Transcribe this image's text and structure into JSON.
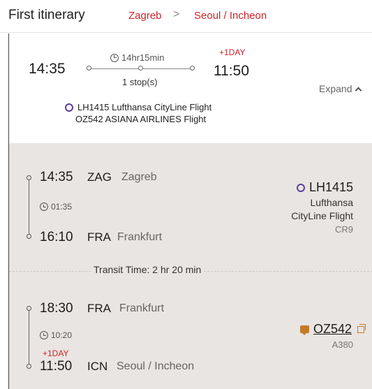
{
  "header": {
    "title": "First itinerary",
    "from": "Zagreb",
    "arrow": ">",
    "to": "Seoul / Incheon"
  },
  "summary": {
    "departure_time": "14:35",
    "arrival_time": "11:50",
    "plus_day": "+1DAY",
    "duration": "14hr15min",
    "stops": "1 stop(s)",
    "expand_label": "Expand",
    "flights": [
      {
        "label": "LH1415 Lufthansa CityLine Flight"
      },
      {
        "label": "OZ542 ASIANA AIRLINES Flight"
      }
    ]
  },
  "segments": [
    {
      "dep_time": "14:35",
      "dep_code": "ZAG",
      "dep_city": "Zagreb",
      "duration": "01:35",
      "arr_time": "16:10",
      "arr_code": "FRA",
      "arr_city": "Frankfurt",
      "flight_no": "LH1415",
      "operator_line1": "Lufthansa",
      "operator_line2": "CityLine Flight",
      "aircraft": "CR9"
    },
    {
      "dep_time": "18:30",
      "dep_code": "FRA",
      "dep_city": "Frankfurt",
      "duration": "10:20",
      "plus_day": "+1DAY",
      "arr_time": "11:50",
      "arr_code": "ICN",
      "arr_city": "Seoul / Incheon",
      "flight_no": "OZ542",
      "aircraft": "A380"
    }
  ],
  "transit": "Transit Time: 2 hr 20 min",
  "colors": {
    "accent_red": "#d1232a",
    "lufthansa_purple": "#5a3fa0",
    "asiana_orange": "#c47a28",
    "detail_bg": "#e9e5e2"
  },
  "icons": {
    "clock": "clock-icon",
    "expand": "chevron-up-icon",
    "lufthansa": "lufthansa-ring-icon",
    "asiana": "asiana-chat-icon",
    "copy": "copy-icon"
  }
}
